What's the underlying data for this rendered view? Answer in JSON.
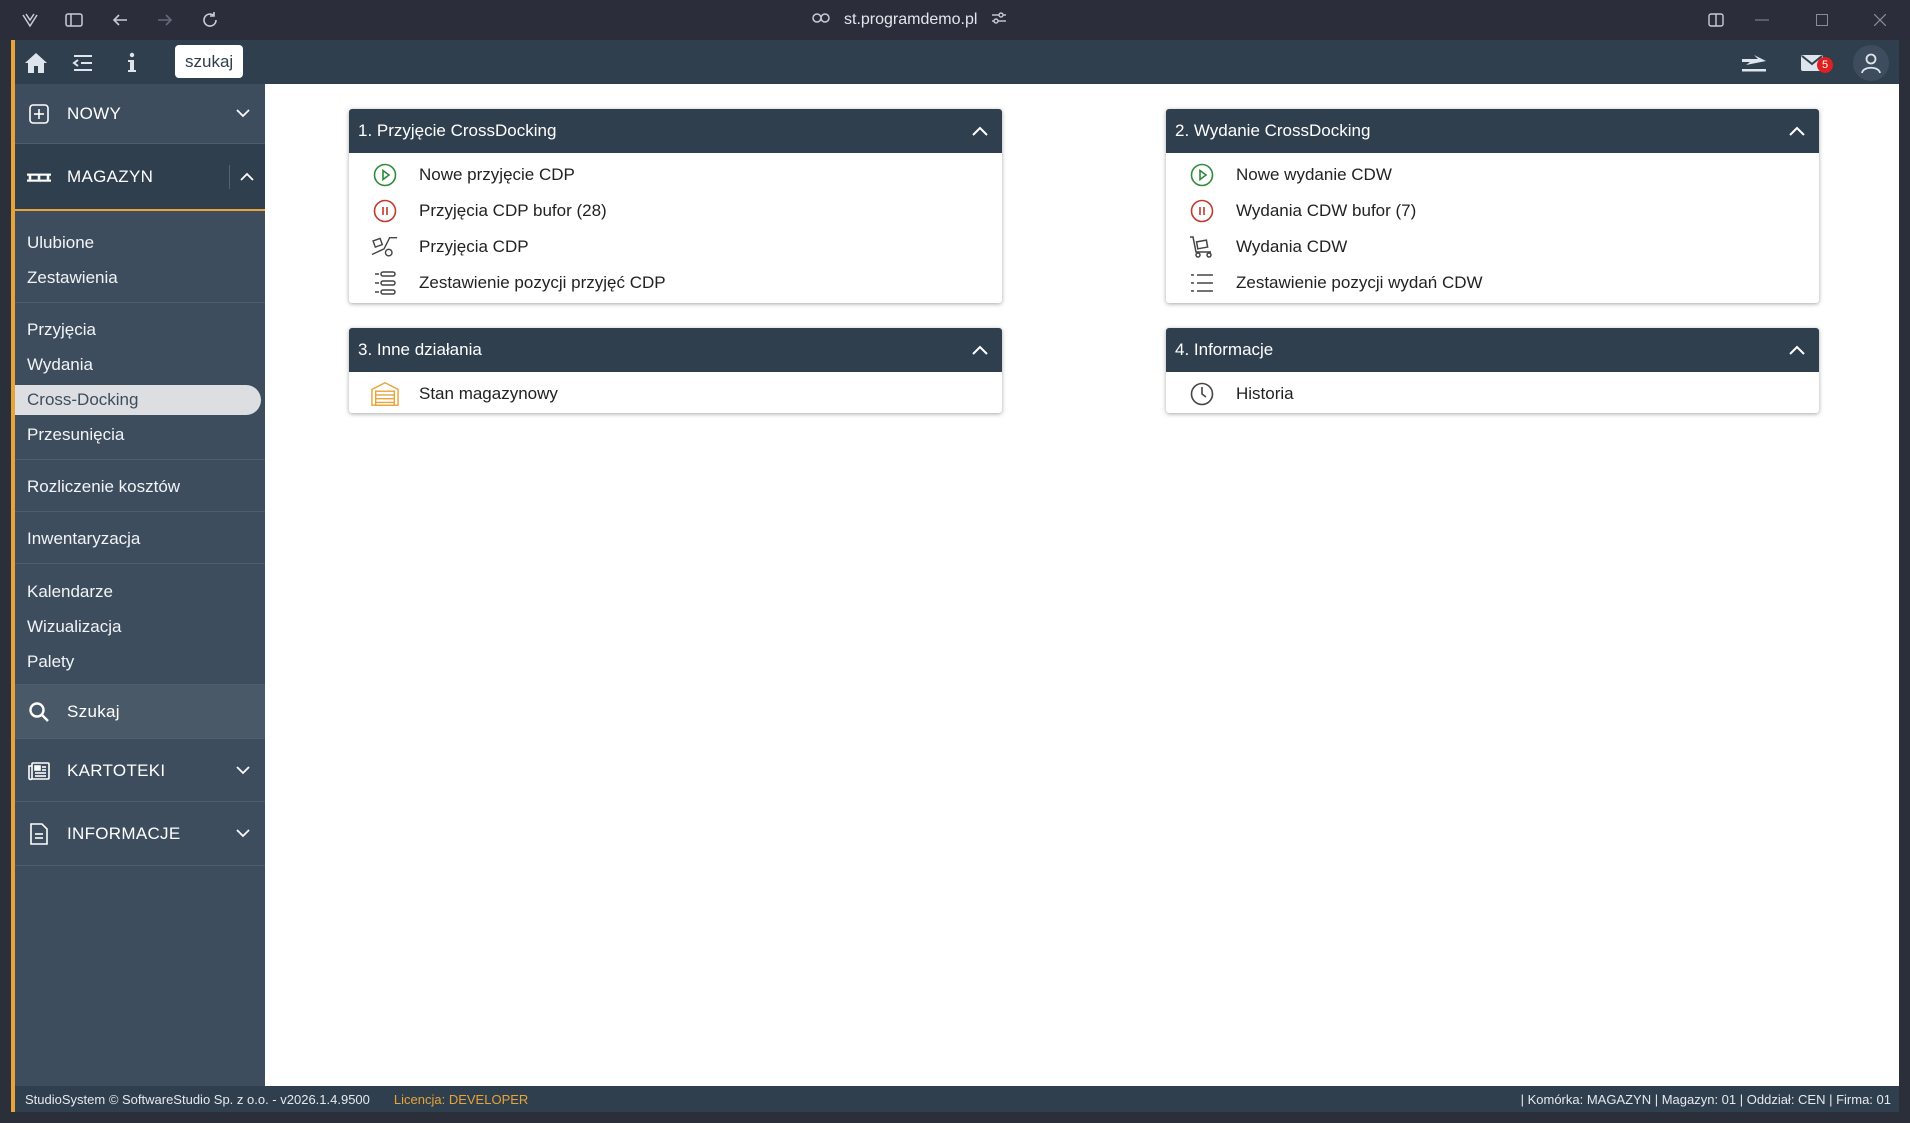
{
  "browser": {
    "url": "st.programdemo.pl"
  },
  "topbar": {
    "search_label": "szukaj",
    "mail_count": "5"
  },
  "sidebar": {
    "sections": {
      "nowy": "NOWY",
      "magazyn": "MAGAZYN",
      "kartoteki": "KARTOTEKI",
      "informacje": "INFORMACJE"
    },
    "links": {
      "ulubione": "Ulubione",
      "zestawienia": "Zestawienia",
      "przyjecia": "Przyjęcia",
      "wydania": "Wydania",
      "cross_docking": "Cross-Docking",
      "przesuniecia": "Przesunięcia",
      "rozliczenie": "Rozliczenie kosztów",
      "inwentaryzacja": "Inwentaryzacja",
      "kalendarze": "Kalendarze",
      "wizualizacja": "Wizualizacja",
      "palety": "Palety",
      "szukaj": "Szukaj"
    }
  },
  "panels": {
    "p1": {
      "title": "1. Przyjęcie CrossDocking",
      "items": [
        "Nowe przyjęcie CDP",
        "Przyjęcia CDP bufor (28)",
        "Przyjęcia CDP",
        "Zestawienie pozycji przyjęć CDP"
      ]
    },
    "p2": {
      "title": "2. Wydanie CrossDocking",
      "items": [
        "Nowe wydanie CDW",
        "Wydania CDW bufor (7)",
        "Wydania CDW",
        "Zestawienie pozycji wydań CDW"
      ]
    },
    "p3": {
      "title": "3. Inne działania",
      "items": [
        "Stan magazynowy"
      ]
    },
    "p4": {
      "title": "4. Informacje",
      "items": [
        "Historia"
      ]
    }
  },
  "footer": {
    "copyright": "StudioSystem © SoftwareStudio Sp. z o.o. - v2026.1.4.9500",
    "license_label": "Licencja:",
    "license_value": "DEVELOPER",
    "status": "| Komórka: MAGAZYN | Magazyn: 01 | Oddział: CEN | Firma: 01"
  },
  "colors": {
    "accent": "#e8a33a",
    "header": "#2f3f4e",
    "sidebar": "#3d4d5d",
    "play_green": "#2e8b3a",
    "pause_red": "#c0392b"
  }
}
